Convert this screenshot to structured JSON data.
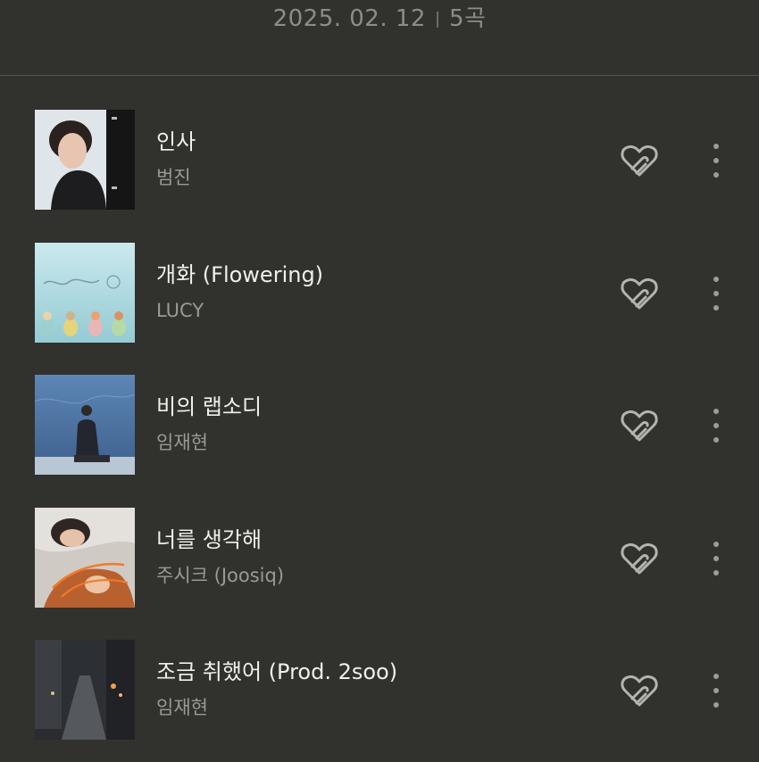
{
  "header": {
    "date": "2025. 02. 12",
    "count": "5곡"
  },
  "songs": [
    {
      "title": "인사",
      "artist": "범진"
    },
    {
      "title": "개화 (Flowering)",
      "artist": "LUCY"
    },
    {
      "title": "비의 랩소디",
      "artist": "임재현"
    },
    {
      "title": "너를 생각해",
      "artist": "주시크 (Joosiq)"
    },
    {
      "title": "조금 취했어 (Prod. 2soo)",
      "artist": "임재현"
    }
  ],
  "icons": {
    "like": "heart-outline-icon",
    "more": "more-vertical-icon"
  },
  "colors": {
    "background": "#31312d",
    "title": "#efefec",
    "subtitle": "#9a9a94",
    "icon": "#b4b4ae"
  }
}
